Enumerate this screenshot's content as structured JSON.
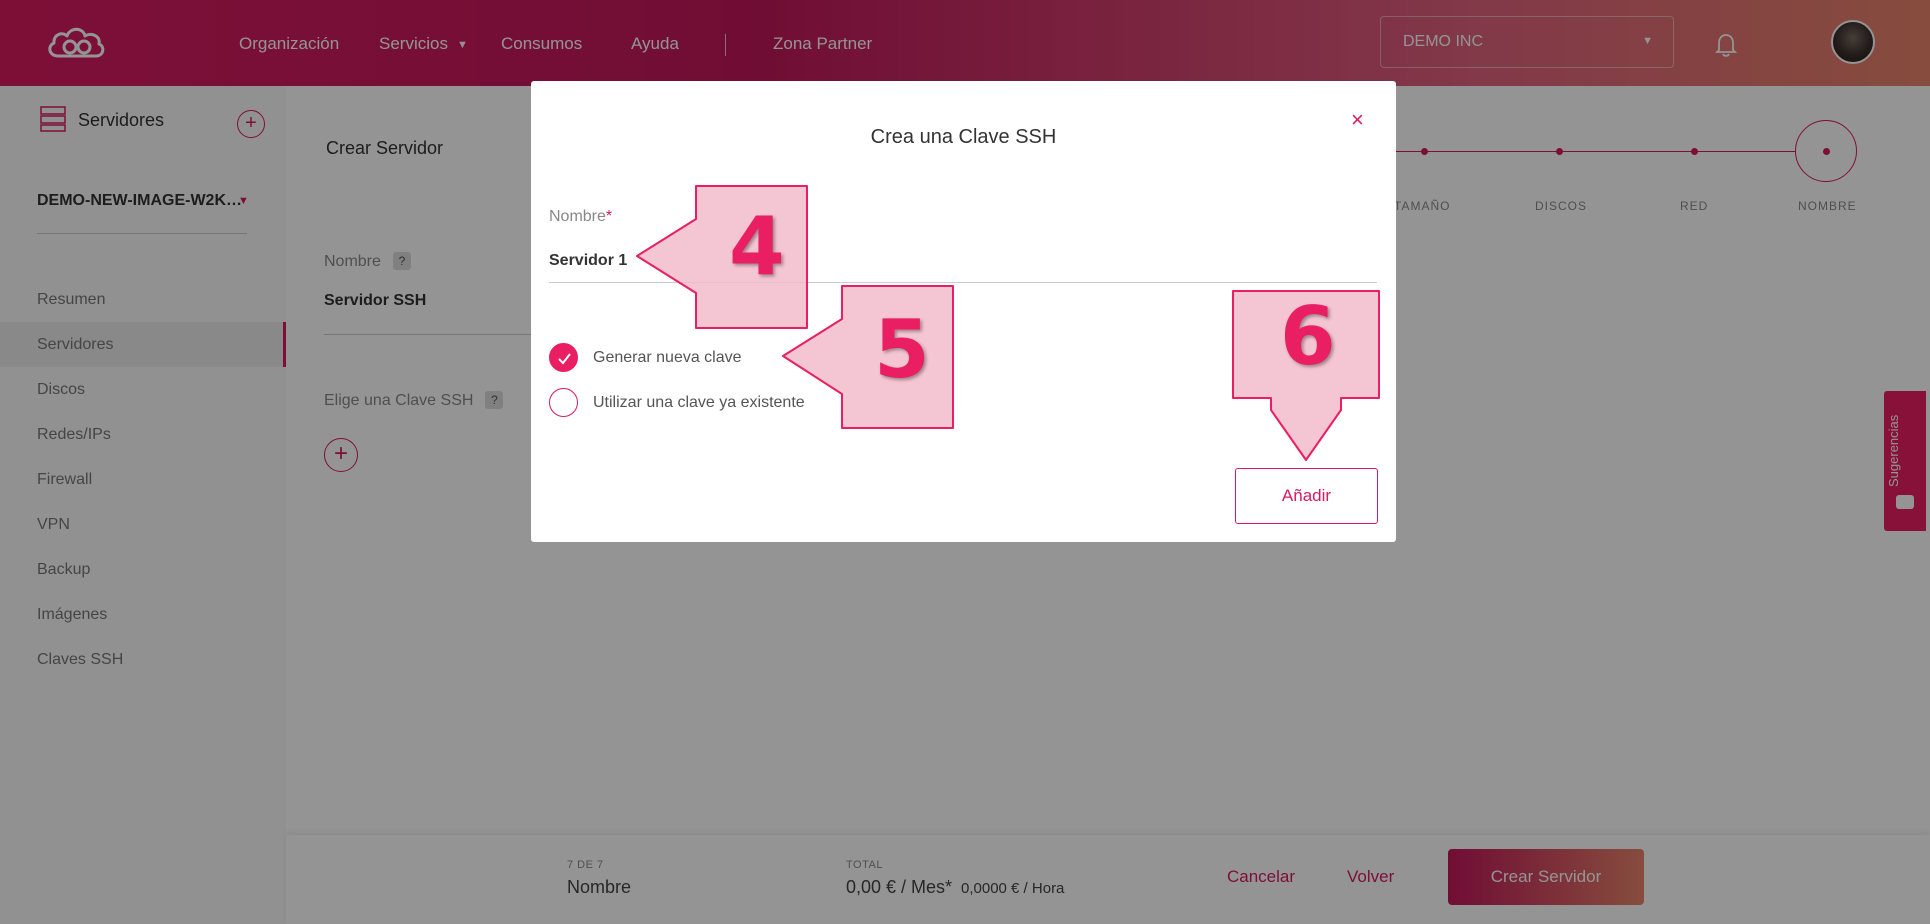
{
  "header": {
    "nav": [
      "Organización",
      "Servicios",
      "Consumos",
      "Ayuda",
      "Zona Partner"
    ],
    "org_select": "DEMO INC"
  },
  "sidebar": {
    "title": "Servidores",
    "server_name": "DEMO-NEW-IMAGE-W2K…",
    "items": [
      "Resumen",
      "Servidores",
      "Discos",
      "Redes/IPs",
      "Firewall",
      "VPN",
      "Backup",
      "Imágenes",
      "Claves SSH"
    ],
    "active_item": "Servidores"
  },
  "main": {
    "title": "Crear Servidor",
    "name_label": "Nombre",
    "name_value": "Servidor SSH",
    "ssh_label": "Elige una Clave SSH",
    "help": "?",
    "add": "+"
  },
  "stepper": {
    "steps": [
      "TAMAÑO",
      "DISCOS",
      "RED",
      "NOMBRE"
    ],
    "current": "NOMBRE"
  },
  "bottom_bar": {
    "step_count": "7 DE 7",
    "step_name": "Nombre",
    "total_label": "TOTAL",
    "total_month": "0,00 € / Mes*",
    "total_hour": "0,0000 € / Hora",
    "cancel": "Cancelar",
    "back": "Volver",
    "create": "Crear Servidor"
  },
  "feedback_tab": {
    "label": "Sugerencias"
  },
  "modal": {
    "title": "Crea una Clave SSH",
    "close": "×",
    "name_label": "Nombre",
    "required_mark": "*",
    "name_value": "Servidor 1",
    "options": [
      "Generar nueva clave",
      "Utilizar una clave ya existente"
    ],
    "selected_option": "Generar nueva clave",
    "add_button": "Añadir"
  },
  "annotations": [
    "4",
    "5",
    "6"
  ],
  "colors": {
    "accent": "#d81b60",
    "accent_bright": "#e91e63",
    "header_gradient_end": "#e8846a",
    "callout_fill": "#f2b8c8"
  }
}
